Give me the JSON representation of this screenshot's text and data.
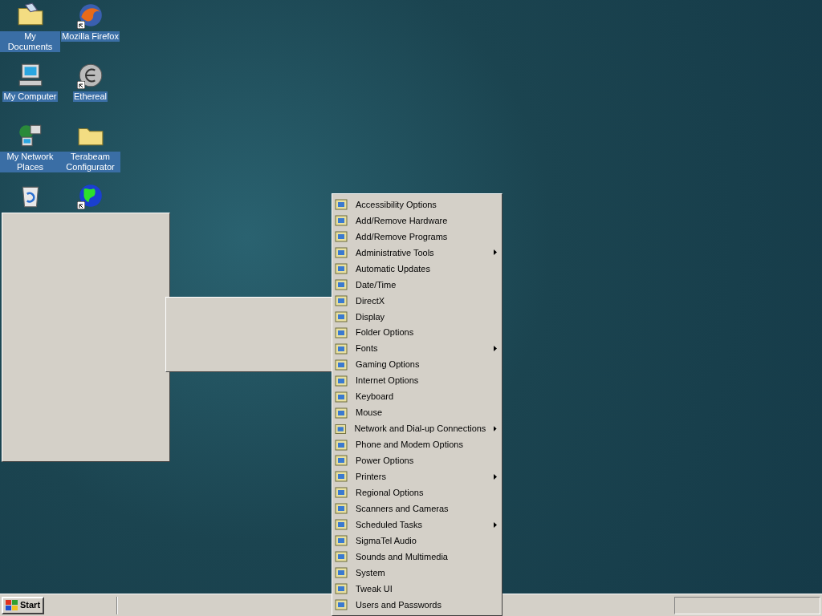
{
  "desktop_icons": [
    {
      "label": "My Documents",
      "kind": "documents",
      "shortcut": false
    },
    {
      "label": "Mozilla Firefox",
      "kind": "browser",
      "shortcut": true
    },
    {
      "label": "My Computer",
      "kind": "computer",
      "shortcut": false
    },
    {
      "label": "Ethereal",
      "kind": "disc",
      "shortcut": true
    },
    {
      "label": "My Network Places",
      "kind": "network",
      "shortcut": false
    },
    {
      "label": "Terabeam Configurator",
      "kind": "folder",
      "shortcut": false
    },
    {
      "kind": "recycle",
      "shortcut": false
    },
    {
      "kind": "globe",
      "shortcut": true
    }
  ],
  "menu": {
    "items": [
      {
        "label": "Accessibility Options",
        "submenu": false
      },
      {
        "label": "Add/Remove Hardware",
        "submenu": false
      },
      {
        "label": "Add/Remove Programs",
        "submenu": false
      },
      {
        "label": "Administrative Tools",
        "submenu": true
      },
      {
        "label": "Automatic Updates",
        "submenu": false
      },
      {
        "label": "Date/Time",
        "submenu": false
      },
      {
        "label": "DirectX",
        "submenu": false
      },
      {
        "label": "Display",
        "submenu": false
      },
      {
        "label": "Folder Options",
        "submenu": false
      },
      {
        "label": "Fonts",
        "submenu": true
      },
      {
        "label": "Gaming Options",
        "submenu": false
      },
      {
        "label": "Internet Options",
        "submenu": false
      },
      {
        "label": "Keyboard",
        "submenu": false
      },
      {
        "label": "Mouse",
        "submenu": false
      },
      {
        "label": "Network and Dial-up Connections",
        "submenu": true
      },
      {
        "label": "Phone and Modem Options",
        "submenu": false
      },
      {
        "label": "Power Options",
        "submenu": false
      },
      {
        "label": "Printers",
        "submenu": true
      },
      {
        "label": "Regional Options",
        "submenu": false
      },
      {
        "label": "Scanners and Cameras",
        "submenu": false
      },
      {
        "label": "Scheduled Tasks",
        "submenu": true
      },
      {
        "label": "SigmaTel Audio",
        "submenu": false
      },
      {
        "label": "Sounds and Multimedia",
        "submenu": false
      },
      {
        "label": "System",
        "submenu": false
      },
      {
        "label": "Tweak UI",
        "submenu": false
      },
      {
        "label": "Users and Passwords",
        "submenu": false
      }
    ]
  },
  "taskbar": {
    "start_label": "Start"
  }
}
